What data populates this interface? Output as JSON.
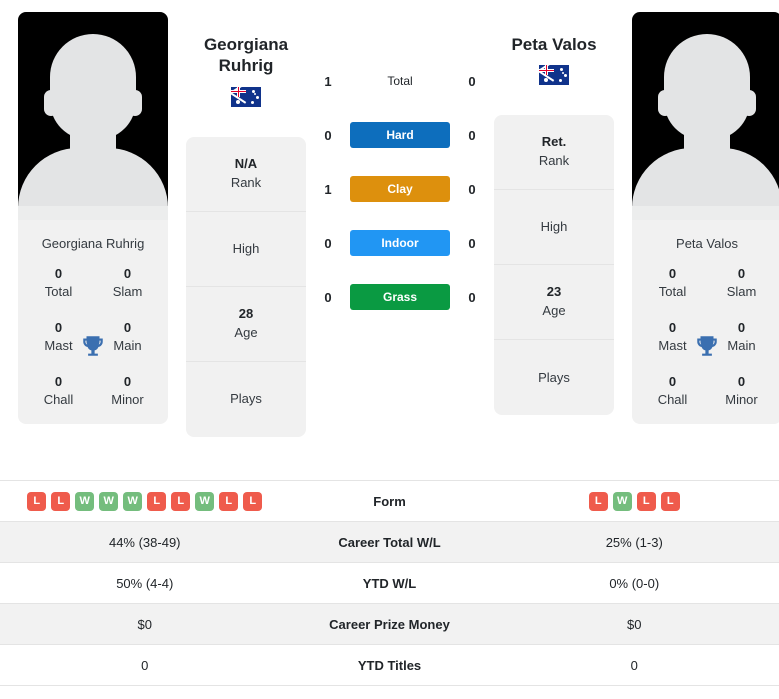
{
  "colors": {
    "hard": "#0d6ebd",
    "clay": "#dd900d",
    "indoor": "#2196f3",
    "grass": "#0a9a42",
    "win": "#74bd7d",
    "loss": "#ef5b4c",
    "trophy": "#3b6fb0"
  },
  "player_left": {
    "name": "Georgiana Ruhrig",
    "name_line1": "Georgiana",
    "name_line2": "Ruhrig",
    "photo_caption": "Georgiana Ruhrig",
    "country_flag": "australia-flag",
    "titles": [
      {
        "value": "0",
        "label": "Total"
      },
      {
        "value": "0",
        "label": "Slam"
      },
      {
        "value": "0",
        "label": "Mast"
      },
      {
        "value": "0",
        "label": "Main"
      },
      {
        "value": "0",
        "label": "Chall"
      },
      {
        "value": "0",
        "label": "Minor"
      }
    ],
    "info": [
      {
        "value": "N/A",
        "label": "Rank"
      },
      {
        "value": "",
        "label": "High"
      },
      {
        "value": "28",
        "label": "Age"
      },
      {
        "value": "",
        "label": "Plays"
      }
    ],
    "form": [
      "L",
      "L",
      "W",
      "W",
      "W",
      "L",
      "L",
      "W",
      "L",
      "L"
    ]
  },
  "player_right": {
    "name": "Peta Valos",
    "name_line1": "Peta Valos",
    "name_line2": "",
    "photo_caption": "Peta Valos",
    "country_flag": "australia-flag",
    "titles": [
      {
        "value": "0",
        "label": "Total"
      },
      {
        "value": "0",
        "label": "Slam"
      },
      {
        "value": "0",
        "label": "Mast"
      },
      {
        "value": "0",
        "label": "Main"
      },
      {
        "value": "0",
        "label": "Chall"
      },
      {
        "value": "0",
        "label": "Minor"
      }
    ],
    "info": [
      {
        "value": "Ret.",
        "label": "Rank"
      },
      {
        "value": "",
        "label": "High"
      },
      {
        "value": "23",
        "label": "Age"
      },
      {
        "value": "",
        "label": "Plays"
      }
    ],
    "form": [
      "L",
      "W",
      "L",
      "L"
    ]
  },
  "surfaces": [
    {
      "label": "Total",
      "left": "1",
      "right": "0",
      "style": "plain",
      "color": ""
    },
    {
      "label": "Hard",
      "left": "0",
      "right": "0",
      "style": "badge",
      "color": "#0d6ebd"
    },
    {
      "label": "Clay",
      "left": "1",
      "right": "0",
      "style": "badge",
      "color": "#dd900d"
    },
    {
      "label": "Indoor",
      "left": "0",
      "right": "0",
      "style": "badge",
      "color": "#2196f3"
    },
    {
      "label": "Grass",
      "left": "0",
      "right": "0",
      "style": "badge",
      "color": "#0a9a42"
    }
  ],
  "stats": [
    {
      "label": "Form",
      "left": "",
      "right": "",
      "type": "form",
      "shaded": false
    },
    {
      "label": "Career Total W/L",
      "left": "44% (38-49)",
      "right": "25% (1-3)",
      "type": "text",
      "shaded": true
    },
    {
      "label": "YTD W/L",
      "left": "50% (4-4)",
      "right": "0% (0-0)",
      "type": "text",
      "shaded": false
    },
    {
      "label": "Career Prize Money",
      "left": "$0",
      "right": "$0",
      "type": "text",
      "shaded": true
    },
    {
      "label": "YTD Titles",
      "left": "0",
      "right": "0",
      "type": "text",
      "shaded": false
    }
  ]
}
